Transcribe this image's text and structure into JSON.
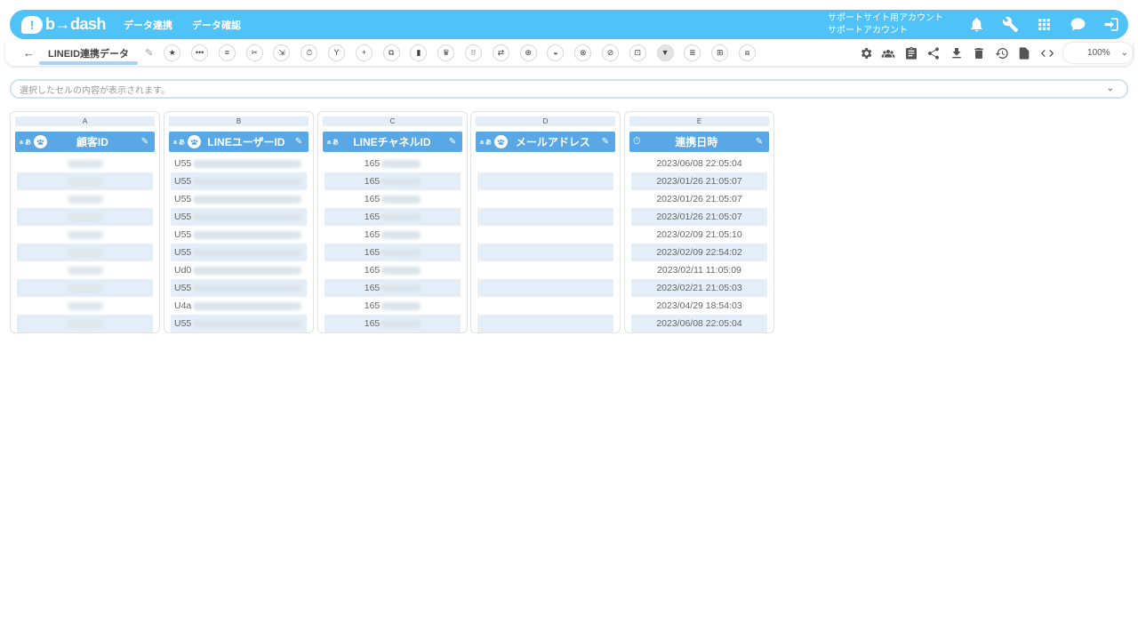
{
  "header": {
    "logo_mark": "!",
    "logo_text": "b→dash",
    "nav": [
      "データ連携",
      "データ確認"
    ],
    "account_line1": "サポートサイト用アカウント",
    "account_line2": "サポートアカウント",
    "icons": [
      "bell-icon",
      "wrench-icon",
      "apps-grid-icon",
      "chat-icon",
      "logout-icon"
    ]
  },
  "toolbar": {
    "back": "←",
    "sheet_title": "LINEID連携データ",
    "edit": "✎",
    "tools": [
      "★",
      "•••",
      "≡",
      "✂",
      "⇲",
      "⏱",
      "Y",
      "+",
      "⧉",
      "▮",
      "♛",
      "⁝⁝",
      "⇄",
      "⊕",
      "◒",
      "⊗",
      "⊘",
      "⊡",
      "▼",
      "≣",
      "⊞",
      "⧈"
    ],
    "right_icons": [
      "gear-icon",
      "users-icon",
      "clipboard-icon",
      "share-icon",
      "download-icon",
      "trash-icon",
      "history-icon",
      "reload-doc-icon",
      "code-icon"
    ],
    "zoom": "100%",
    "zoom_chevron": "⌄"
  },
  "formula_bar": {
    "placeholder": "選択したセルの内容が表示されます。",
    "chevron": "⌄"
  },
  "columns": [
    {
      "letter": "A",
      "badge": "a あ",
      "label": "顧客ID",
      "edit": "✎",
      "kind": "group",
      "align": "center",
      "cells": [
        "",
        "",
        "",
        "",
        "",
        "",
        "",
        "",
        "",
        ""
      ]
    },
    {
      "letter": "B",
      "badge": "a あ",
      "label": "LINEユーザーID",
      "edit": "✎",
      "kind": "group",
      "align": "left",
      "cells": [
        "U55",
        "U55",
        "U55",
        "U55",
        "U55",
        "U55",
        "Ud0",
        "U55",
        "U4a",
        "U55"
      ]
    },
    {
      "letter": "C",
      "badge": "a あ",
      "label": "LINEチャネルID",
      "edit": "✎",
      "kind": "none",
      "align": "center",
      "cells": [
        "165",
        "165",
        "165",
        "165",
        "165",
        "165",
        "165",
        "165",
        "165",
        "165"
      ]
    },
    {
      "letter": "D",
      "badge": "a あ",
      "label": "メールアドレス",
      "edit": "✎",
      "kind": "group",
      "align": "center",
      "cells": [
        "",
        "",
        "",
        "",
        "",
        "",
        "",
        "",
        "",
        ""
      ]
    },
    {
      "letter": "E",
      "badge": "",
      "label": "連携日時",
      "edit": "✎",
      "kind": "timer",
      "align": "center",
      "cells": [
        "2023/06/08 22:05:04",
        "2023/01/26 21:05:07",
        "2023/01/26 21:05:07",
        "2023/01/26 21:05:07",
        "2023/02/09 21:05:10",
        "2023/02/09 22:54:02",
        "2023/02/11 11:05:09",
        "2023/02/21 21:05:03",
        "2023/04/29 18:54:03",
        "2023/06/08 22:05:04"
      ]
    }
  ]
}
